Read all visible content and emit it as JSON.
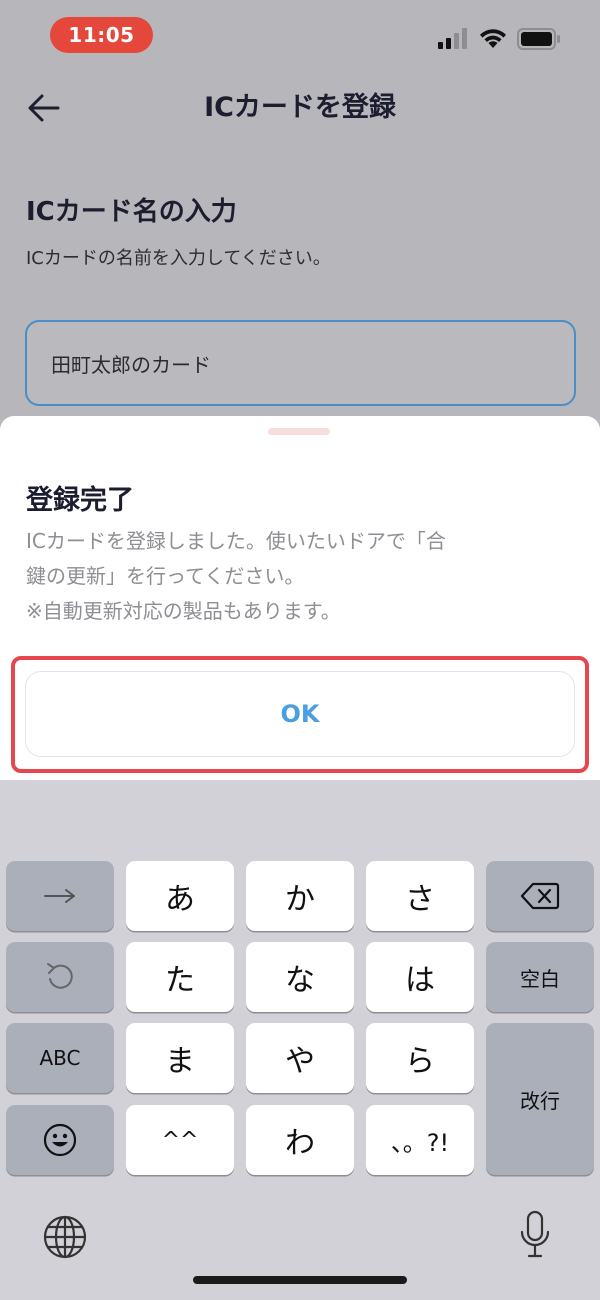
{
  "status_bar": {
    "time": "11:05"
  },
  "nav": {
    "title": "ICカードを登録"
  },
  "form": {
    "section_title": "ICカード名の入力",
    "section_desc": "ICカードの名前を入力してください。",
    "name_value": "田町太郎のカード"
  },
  "sheet": {
    "title": "登録完了",
    "message_line1": "ICカードを登録しました。使いたいドアで「合",
    "message_line2": "鍵の更新」を行ってください。",
    "message_line3": "※自動更新対応の製品もあります。",
    "ok_label": "OK"
  },
  "keyboard": {
    "row1": [
      "あ",
      "か",
      "さ"
    ],
    "row2": [
      "た",
      "な",
      "は"
    ],
    "row3": [
      "ま",
      "や",
      "ら"
    ],
    "row4": [
      "^^",
      "わ",
      "、。?!"
    ],
    "abc_label": "ABC",
    "space_label": "空白",
    "return_label": "改行",
    "icons": [
      "arrow-right-icon",
      "undo-icon",
      "emoji-icon",
      "delete-icon",
      "globe-icon",
      "mic-icon"
    ]
  },
  "colors": {
    "time_pill": "#e5483a",
    "accent_blue": "#4a9ee2",
    "highlight_red": "#e6474f",
    "input_border": "#4a8fc4"
  }
}
